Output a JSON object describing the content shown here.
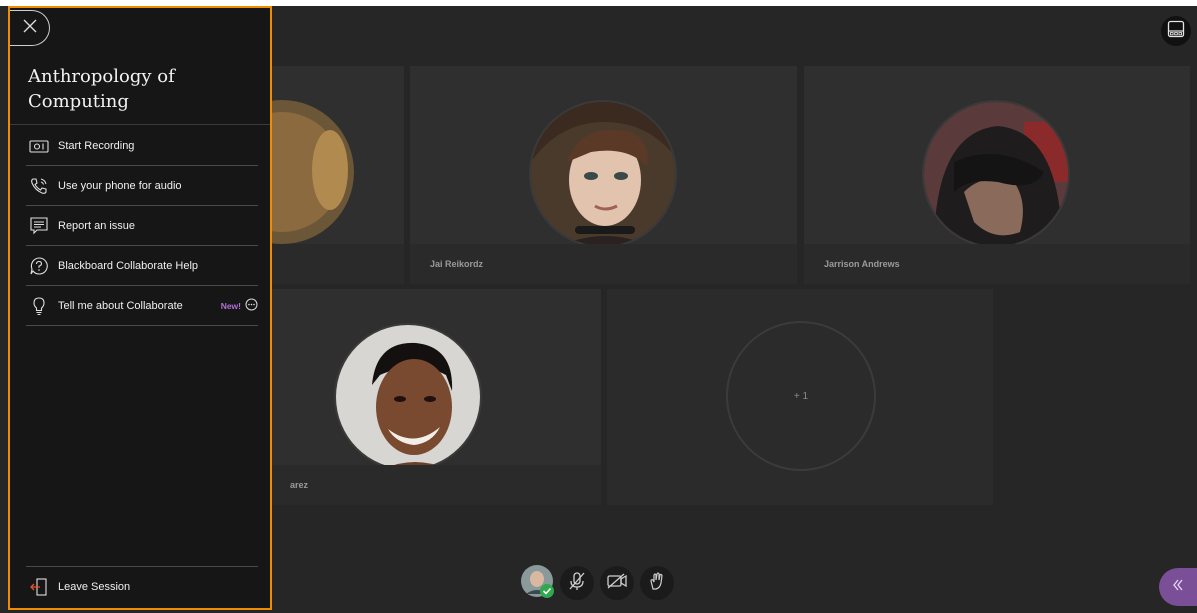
{
  "sidebar": {
    "session_title": "Anthropology of Computing",
    "close_icon": "close-icon",
    "items": [
      {
        "label": "Start Recording",
        "icon": "record-camera-icon"
      },
      {
        "label": "Use your phone for audio",
        "icon": "phone-audio-icon"
      },
      {
        "label": "Report an issue",
        "icon": "report-issue-icon"
      },
      {
        "label": "Blackboard Collaborate Help",
        "icon": "help-icon"
      },
      {
        "label": "Tell me about Collaborate",
        "icon": "lightbulb-icon",
        "badge": "New!"
      }
    ],
    "leave_label": "Leave Session",
    "leave_icon": "leave-door-icon",
    "accent_color": "#f08c00"
  },
  "participants": [
    {
      "name": ""
    },
    {
      "name": "Jai Reikordz"
    },
    {
      "name": "Jarrison Andrews"
    },
    {
      "name": "arez"
    }
  ],
  "overflow_count": "+ 1",
  "controls": [
    {
      "name": "my-avatar-status",
      "icon": "avatar-check-icon"
    },
    {
      "name": "microphone",
      "icon": "mic-off-icon"
    },
    {
      "name": "camera",
      "icon": "camera-off-icon"
    },
    {
      "name": "raise-hand",
      "icon": "hand-icon"
    }
  ],
  "colors": {
    "background": "#262626",
    "tile": "#2f2f2f",
    "collab_panel": "#7a4f98",
    "badge_new": "#b36fd6"
  }
}
